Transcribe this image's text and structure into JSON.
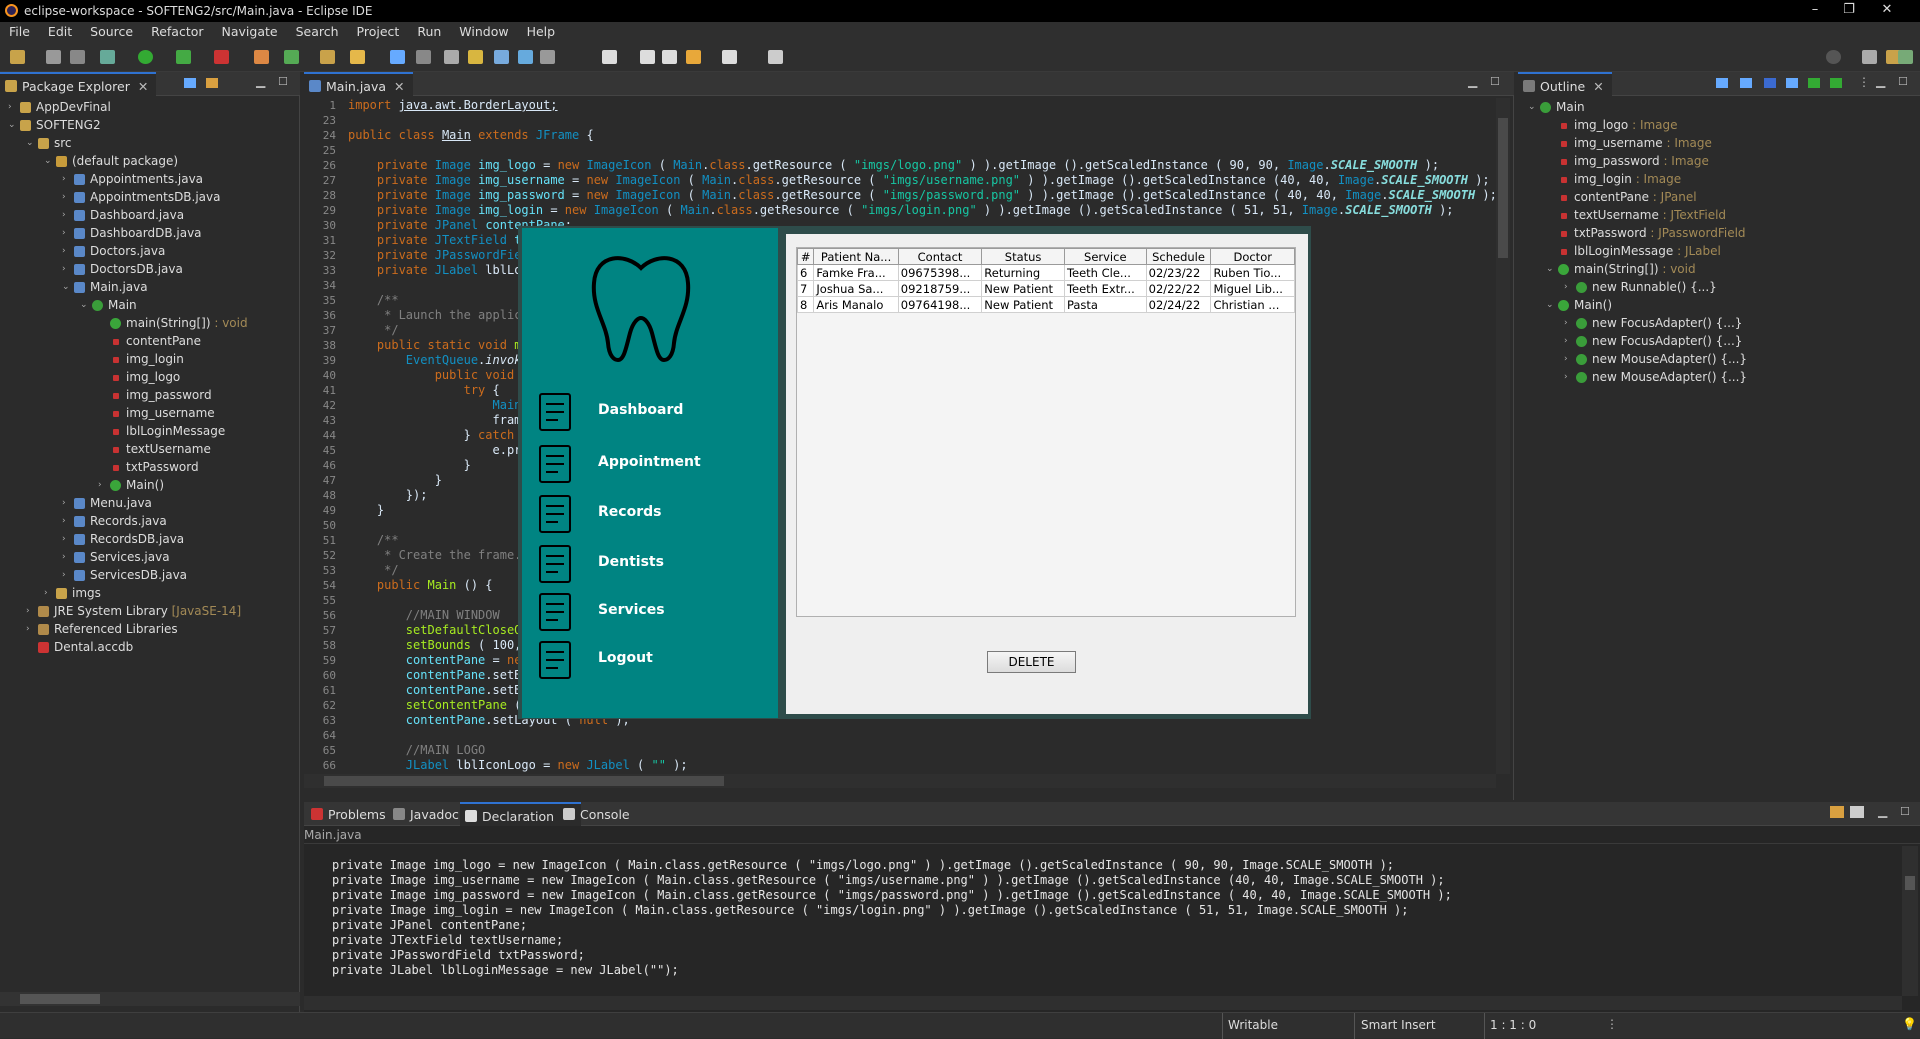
{
  "window": {
    "title": "eclipse-workspace - SOFTENG2/src/Main.java - Eclipse IDE"
  },
  "menu": [
    "File",
    "Edit",
    "Source",
    "Refactor",
    "Navigate",
    "Search",
    "Project",
    "Run",
    "Window",
    "Help"
  ],
  "package_explorer": {
    "tab": "Package Explorer",
    "items": [
      {
        "label": "AppDevFinal",
        "indent": 0,
        "arrow": "›",
        "icon": "project"
      },
      {
        "label": "SOFTENG2",
        "indent": 0,
        "arrow": "⌄",
        "icon": "project"
      },
      {
        "label": "src",
        "indent": 1,
        "arrow": "⌄",
        "icon": "folder"
      },
      {
        "label": "(default package)",
        "indent": 2,
        "arrow": "⌄",
        "icon": "package"
      },
      {
        "label": "Appointments.java",
        "indent": 3,
        "arrow": "›",
        "icon": "java"
      },
      {
        "label": "AppointmentsDB.java",
        "indent": 3,
        "arrow": "›",
        "icon": "java"
      },
      {
        "label": "Dashboard.java",
        "indent": 3,
        "arrow": "›",
        "icon": "java"
      },
      {
        "label": "DashboardDB.java",
        "indent": 3,
        "arrow": "›",
        "icon": "java"
      },
      {
        "label": "Doctors.java",
        "indent": 3,
        "arrow": "›",
        "icon": "java"
      },
      {
        "label": "DoctorsDB.java",
        "indent": 3,
        "arrow": "›",
        "icon": "java"
      },
      {
        "label": "Main.java",
        "indent": 3,
        "arrow": "⌄",
        "icon": "java"
      },
      {
        "label": "Main",
        "indent": 4,
        "arrow": "⌄",
        "icon": "class"
      },
      {
        "label": "main(String[])",
        "extra": " : void",
        "indent": 5,
        "arrow": "",
        "icon": "method"
      },
      {
        "label": "contentPane",
        "indent": 5,
        "arrow": "",
        "icon": "field"
      },
      {
        "label": "img_login",
        "indent": 5,
        "arrow": "",
        "icon": "field"
      },
      {
        "label": "img_logo",
        "indent": 5,
        "arrow": "",
        "icon": "field"
      },
      {
        "label": "img_password",
        "indent": 5,
        "arrow": "",
        "icon": "field"
      },
      {
        "label": "img_username",
        "indent": 5,
        "arrow": "",
        "icon": "field"
      },
      {
        "label": "lblLoginMessage",
        "indent": 5,
        "arrow": "",
        "icon": "field"
      },
      {
        "label": "textUsername",
        "indent": 5,
        "arrow": "",
        "icon": "field"
      },
      {
        "label": "txtPassword",
        "indent": 5,
        "arrow": "",
        "icon": "field"
      },
      {
        "label": "Main()",
        "indent": 5,
        "arrow": "›",
        "icon": "method"
      },
      {
        "label": "Menu.java",
        "indent": 3,
        "arrow": "›",
        "icon": "java"
      },
      {
        "label": "Records.java",
        "indent": 3,
        "arrow": "›",
        "icon": "java"
      },
      {
        "label": "RecordsDB.java",
        "indent": 3,
        "arrow": "›",
        "icon": "java"
      },
      {
        "label": "Services.java",
        "indent": 3,
        "arrow": "›",
        "icon": "java"
      },
      {
        "label": "ServicesDB.java",
        "indent": 3,
        "arrow": "›",
        "icon": "java"
      },
      {
        "label": "imgs",
        "indent": 2,
        "arrow": "›",
        "icon": "folder"
      },
      {
        "label": "JRE System Library",
        "extra": " [JavaSE-14]",
        "indent": 1,
        "arrow": "›",
        "icon": "library"
      },
      {
        "label": "Referenced Libraries",
        "indent": 1,
        "arrow": "›",
        "icon": "library"
      },
      {
        "label": "Dental.accdb",
        "indent": 1,
        "arrow": "",
        "icon": "file"
      }
    ]
  },
  "editor": {
    "tab": "Main.java",
    "lines": [
      {
        "n": "1",
        "h": "<span class='kw'>import</span> <u>java.awt.BorderLayout;</u>"
      },
      {
        "n": "23",
        "h": ""
      },
      {
        "n": "24",
        "h": "<span class='kw'>public class</span> <u>Main</u> <span class='kw'>extends</span> <span class='ty'>JFrame</span> {"
      },
      {
        "n": "25",
        "h": ""
      },
      {
        "n": "26",
        "h": "    <span class='kw'>private</span> <span class='ty'>Image</span> <span class='fl'>img_logo</span> = <span class='kw'>new</span> <span class='ty'>ImageIcon</span> ( <span class='ty'>Main</span>.<span class='kw'>class</span>.getResource ( <span class='st'>\"imgs/logo.png\"</span> ) ).getImage ().getScaledInstance ( 90, 90, <span class='ty'>Image</span>.<span class='it'>SCALE_SMOOTH</span> );"
      },
      {
        "n": "27",
        "h": "    <span class='kw'>private</span> <span class='ty'>Image</span> <span class='fl'>img_username</span> = <span class='kw'>new</span> <span class='ty'>ImageIcon</span> ( <span class='ty'>Main</span>.<span class='kw'>class</span>.getResource ( <span class='st'>\"imgs/username.png\"</span> ) ).getImage ().getScaledInstance (40, 40, <span class='ty'>Image</span>.<span class='it'>SCALE_SMOOTH</span> );"
      },
      {
        "n": "28",
        "h": "    <span class='kw'>private</span> <span class='ty'>Image</span> <span class='fl'>img_password</span> = <span class='kw'>new</span> <span class='ty'>ImageIcon</span> ( <span class='ty'>Main</span>.<span class='kw'>class</span>.getResource ( <span class='st'>\"imgs/password.png\"</span> ) ).getImage ().getScaledInstance ( 40, 40, <span class='ty'>Image</span>.<span class='it'>SCALE_SMOOTH</span> );"
      },
      {
        "n": "29",
        "h": "    <span class='kw'>private</span> <span class='ty'>Image</span> <span class='fl'>img_login</span> = <span class='kw'>new</span> <span class='ty'>ImageIcon</span> ( <span class='ty'>Main</span>.<span class='kw'>class</span>.getResource ( <span class='st'>\"imgs/login.png\"</span> ) ).getImage ().getScaledInstance ( 51, 51, <span class='ty'>Image</span>.<span class='it'>SCALE_SMOOTH</span> );"
      },
      {
        "n": "30",
        "h": "    <span class='kw'>private</span> <span class='ty'>JPanel</span> <span class='fl'>contentPane</span>;"
      },
      {
        "n": "31",
        "h": "    <span class='kw'>private</span> <span class='ty'>JTextField</span> <span class='fl'>te</span>"
      },
      {
        "n": "32",
        "h": "    <span class='kw'>private</span> <span class='ty'>JPasswordFie</span>"
      },
      {
        "n": "33",
        "h": "    <span class='kw'>private</span> <span class='ty'>JLabel</span> lblLog"
      },
      {
        "n": "34",
        "h": ""
      },
      {
        "n": "35",
        "h": "    <span class='cm'>/**</span>"
      },
      {
        "n": "36",
        "h": "    <span class='cm'> * Launch the applica</span>"
      },
      {
        "n": "37",
        "h": "    <span class='cm'> */</span>"
      },
      {
        "n": "38",
        "h": "    <span class='kw'>public static void</span> <span class='mt'>ma</span>"
      },
      {
        "n": "39",
        "h": "        <span class='ty'>EventQueue</span>.<i>invoke</i>"
      },
      {
        "n": "40",
        "h": "            <span class='kw'>public void</span> r"
      },
      {
        "n": "41",
        "h": "                <span class='kw'>try</span> {"
      },
      {
        "n": "42",
        "h": "                    <span class='ty'>Main</span>"
      },
      {
        "n": "43",
        "h": "                    frame"
      },
      {
        "n": "44",
        "h": "                } <span class='kw'>catch</span> ("
      },
      {
        "n": "45",
        "h": "                    e.pri"
      },
      {
        "n": "46",
        "h": "                }"
      },
      {
        "n": "47",
        "h": "            }"
      },
      {
        "n": "48",
        "h": "        });"
      },
      {
        "n": "49",
        "h": "    }"
      },
      {
        "n": "50",
        "h": ""
      },
      {
        "n": "51",
        "h": "    <span class='cm'>/**</span>"
      },
      {
        "n": "52",
        "h": "    <span class='cm'> * Create the frame.</span>"
      },
      {
        "n": "53",
        "h": "    <span class='cm'> */</span>"
      },
      {
        "n": "54",
        "h": "    <span class='kw'>public</span> <span class='mt'>Main</span> () {"
      },
      {
        "n": "55",
        "h": ""
      },
      {
        "n": "56",
        "h": "        <span class='cm'>//MAIN WINDOW</span>"
      },
      {
        "n": "57",
        "h": "        <span class='mt'>setDefaultCloseOp</span>"
      },
      {
        "n": "58",
        "h": "        <span class='mt'>setBounds</span> ( 100,"
      },
      {
        "n": "59",
        "h": "        <span class='fl'>contentPane</span> = <span class='kw'>new</span>"
      },
      {
        "n": "60",
        "h": "        <span class='fl'>contentPane</span>.setBa"
      },
      {
        "n": "61",
        "h": "        <span class='fl'>contentPane</span>.setBo"
      },
      {
        "n": "62",
        "h": "        <span class='mt'>setContentPane</span> ("
      },
      {
        "n": "63",
        "h": "        <span class='fl'>contentPane</span>.setLayout ( <span class='kw'>null</span> );"
      },
      {
        "n": "64",
        "h": ""
      },
      {
        "n": "65",
        "h": "        <span class='cm'>//MAIN LOGO</span>"
      },
      {
        "n": "66",
        "h": "        <span class='ty'>JLabel</span> lblIconLogo = <span class='kw'>new</span> <span class='ty'>JLabel</span> ( <span class='st'>\"\"</span> );"
      }
    ]
  },
  "outline": {
    "tab": "Outline",
    "items": [
      {
        "label": "Main",
        "indent": 0,
        "arrow": "⌄",
        "icon": "class"
      },
      {
        "label": "img_logo",
        "extra": " : Image",
        "indent": 1,
        "arrow": "",
        "icon": "field"
      },
      {
        "label": "img_username",
        "extra": " : Image",
        "indent": 1,
        "arrow": "",
        "icon": "field"
      },
      {
        "label": "img_password",
        "extra": " : Image",
        "indent": 1,
        "arrow": "",
        "icon": "field"
      },
      {
        "label": "img_login",
        "extra": " : Image",
        "indent": 1,
        "arrow": "",
        "icon": "field"
      },
      {
        "label": "contentPane",
        "extra": " : JPanel",
        "indent": 1,
        "arrow": "",
        "icon": "field"
      },
      {
        "label": "textUsername",
        "extra": " : JTextField",
        "indent": 1,
        "arrow": "",
        "icon": "field"
      },
      {
        "label": "txtPassword",
        "extra": " : JPasswordField",
        "indent": 1,
        "arrow": "",
        "icon": "field"
      },
      {
        "label": "lblLoginMessage",
        "extra": " : JLabel",
        "indent": 1,
        "arrow": "",
        "icon": "field"
      },
      {
        "label": "main(String[])",
        "extra": " : void",
        "indent": 1,
        "arrow": "⌄",
        "icon": "method"
      },
      {
        "label": "new Runnable() {...}",
        "indent": 2,
        "arrow": "›",
        "icon": "anon"
      },
      {
        "label": "Main()",
        "indent": 1,
        "arrow": "⌄",
        "icon": "method"
      },
      {
        "label": "new FocusAdapter() {...}",
        "indent": 2,
        "arrow": "›",
        "icon": "anon"
      },
      {
        "label": "new FocusAdapter() {...}",
        "indent": 2,
        "arrow": "›",
        "icon": "anon"
      },
      {
        "label": "new MouseAdapter() {...}",
        "indent": 2,
        "arrow": "›",
        "icon": "anon"
      },
      {
        "label": "new MouseAdapter() {...}",
        "indent": 2,
        "arrow": "›",
        "icon": "anon"
      }
    ]
  },
  "bottom": {
    "tabs": [
      "Problems",
      "Javadoc",
      "Declaration",
      "Console"
    ],
    "active": "Declaration",
    "crumb": "Main.java",
    "lines": [
      "private Image img_logo = new ImageIcon ( Main.class.getResource ( \"imgs/logo.png\" ) ).getImage ().getScaledInstance ( 90, 90, Image.SCALE_SMOOTH );",
      "private Image img_username = new ImageIcon ( Main.class.getResource ( \"imgs/username.png\" ) ).getImage ().getScaledInstance (40, 40, Image.SCALE_SMOOTH );",
      "private Image img_password = new ImageIcon ( Main.class.getResource ( \"imgs/password.png\" ) ).getImage ().getScaledInstance ( 40, 40, Image.SCALE_SMOOTH );",
      "private Image img_login = new ImageIcon ( Main.class.getResource ( \"imgs/login.png\" ) ).getImage ().getScaledInstance ( 51, 51, Image.SCALE_SMOOTH );",
      "private JPanel contentPane;",
      "private JTextField textUsername;",
      "private JPasswordField txtPassword;",
      "private JLabel lblLoginMessage = new JLabel(\"\");"
    ]
  },
  "app": {
    "nav": [
      "Dashboard",
      "Appointment",
      "Records",
      "Dentists",
      "Services",
      "Logout"
    ],
    "columns": [
      "#",
      "Patient Na...",
      "Contact",
      "Status",
      "Service",
      "Schedule",
      "Doctor"
    ],
    "rows": [
      [
        "6",
        "Famke Fra...",
        "09675398...",
        "Returning",
        "Teeth Cle...",
        "02/23/22",
        "Ruben Tio..."
      ],
      [
        "7",
        "Joshua Sa...",
        "09218759...",
        "New Patient",
        "Teeth Extr...",
        "02/22/22",
        "Miguel Lib..."
      ],
      [
        "8",
        "Aris Manalo",
        "09764198...",
        "New Patient",
        "Pasta",
        "02/24/22",
        "Christian ..."
      ]
    ],
    "delete_label": "DELETE"
  },
  "status": {
    "writable": "Writable",
    "insert": "Smart Insert",
    "pos": "1 : 1 : 0"
  },
  "colors": {
    "sidebar": "#008482",
    "accent": "#2f72d1"
  }
}
